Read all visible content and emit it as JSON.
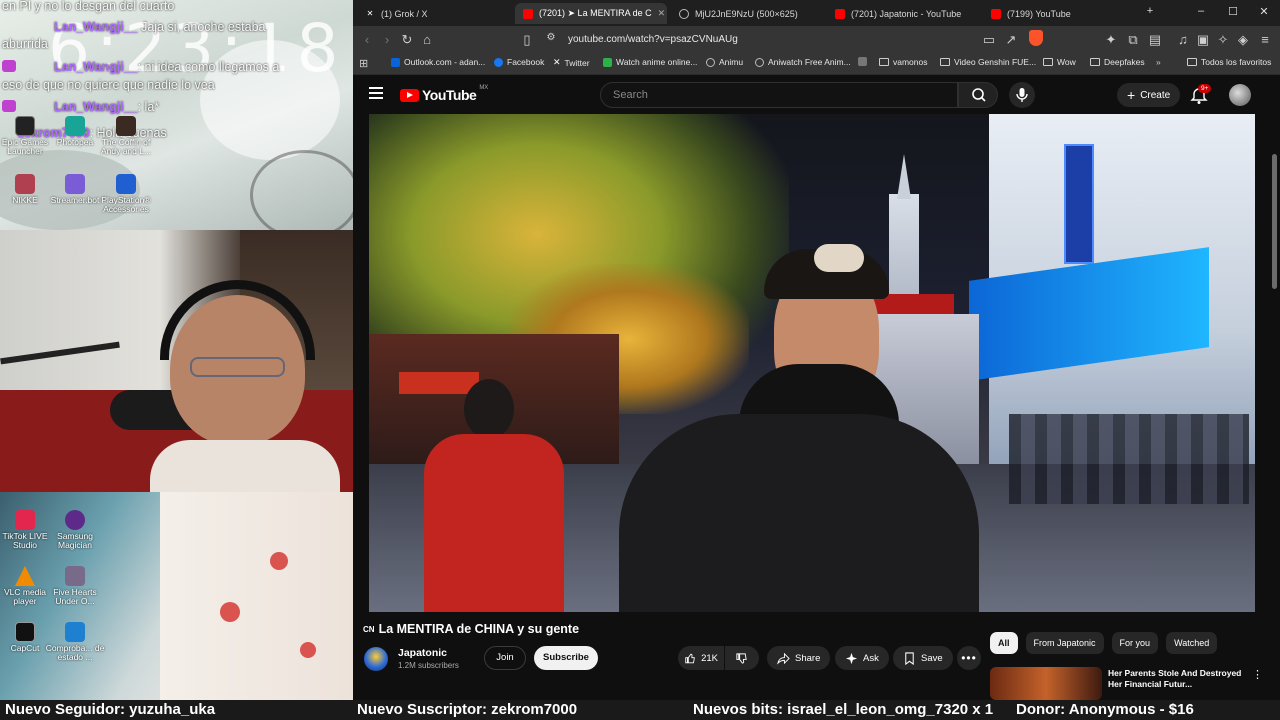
{
  "overlay": {
    "clock": "6:23:18",
    "chat": [
      {
        "user": "",
        "text": "en PI y no lo desgan del cuarto"
      },
      {
        "user": "Lan_Wangji__",
        "text": "Jaja si, anoche estaba"
      },
      {
        "user": "",
        "text": "aburrida"
      },
      {
        "user": "Lan_Wangji__",
        "text": ": ni idea como llegamos a"
      },
      {
        "user": "",
        "text": "eso de que no quiere que nadie lo vea"
      },
      {
        "user": "Lan_Wangji__",
        "text": ": la*"
      },
      {
        "user": "zekrom7000",
        "text": ": Hola buenas"
      }
    ],
    "desktop_icons": [
      {
        "label": "Epic Games Launcher",
        "icon": "epic-games-icon",
        "color": "#222222"
      },
      {
        "label": "Photopea",
        "icon": "photopea-icon",
        "color": "#18a497"
      },
      {
        "label": "The Coffin of Andy and L...",
        "icon": "coffin-game-icon",
        "color": "#3a2a22"
      },
      {
        "label": "NIKKE",
        "icon": "nikke-icon",
        "color": "#b04050"
      },
      {
        "label": "Streamer.bot",
        "icon": "streamerbot-icon",
        "color": "#7a5cd6"
      },
      {
        "label": "PlayStation® Accessories",
        "icon": "playstation-icon",
        "color": "#1f5fd0"
      },
      {
        "label": "TikTok LIVE Studio",
        "icon": "tiktok-icon",
        "color": "#e3264d"
      },
      {
        "label": "Samsung Magician",
        "icon": "samsung-magician-icon",
        "color": "#5d2a8a"
      },
      {
        "label": "VLC media player",
        "icon": "vlc-icon",
        "color": "#f08a00"
      },
      {
        "label": "Five Hearts Under O...",
        "icon": "five-hearts-icon",
        "color": "#7a6a8a"
      },
      {
        "label": "CapCut",
        "icon": "capcut-icon",
        "color": "#111111"
      },
      {
        "label": "Comproba... de estado ...",
        "icon": "status-check-icon",
        "color": "#1f7fd0"
      }
    ]
  },
  "browser": {
    "tabs": [
      {
        "title": "(1) Grok / X",
        "icon": "x-icon",
        "active": false
      },
      {
        "title": "(7201) ➤ La MENTIRA de C",
        "icon": "youtube-icon",
        "active": true
      },
      {
        "title": "MjU2JnE9NzU (500×625)",
        "icon": "globe-icon",
        "active": false
      },
      {
        "title": "(7201) Japatonic - YouTube",
        "icon": "youtube-icon",
        "active": false
      },
      {
        "title": "(7199) YouTube",
        "icon": "youtube-icon",
        "active": false
      }
    ],
    "url": "youtube.com/watch?v=psazCVNuAUg",
    "bookmarks": [
      {
        "label": "Outlook.com - adan...",
        "color": "#0a64d8"
      },
      {
        "label": "Facebook",
        "color": "#1877f2"
      },
      {
        "label": "Twitter",
        "color": "#000000"
      },
      {
        "label": "Watch anime online...",
        "color": "#2bb34a"
      },
      {
        "label": "Animu",
        "color": "#777777"
      },
      {
        "label": "Aniwatch Free Anim...",
        "color": "#777777"
      },
      {
        "label": "",
        "color": "#777777"
      },
      {
        "label": "vamonos",
        "color": "folder"
      },
      {
        "label": "Video Genshin FUE...",
        "color": "folder"
      },
      {
        "label": "Wow",
        "color": "folder"
      },
      {
        "label": "Deepfakes",
        "color": "folder"
      }
    ],
    "bookmarks_all": "Todos los favoritos"
  },
  "youtube": {
    "logo_text": "YouTube",
    "logo_country": "MX",
    "search_placeholder": "Search",
    "create_label": "Create",
    "notif_count": "9+",
    "video_title": "La MENTIRA de CHINA y su gente",
    "title_flag": "CN",
    "channel": {
      "name": "Japatonic",
      "subs": "1.2M subscribers",
      "join": "Join",
      "subscribe": "Subscribe"
    },
    "actions": {
      "likes": "21K",
      "share": "Share",
      "ask": "Ask",
      "save": "Save"
    },
    "chips": [
      "All",
      "From Japatonic",
      "For you",
      "Watched"
    ],
    "rec_title": "Her Parents Stole And Destroyed Her Financial Futur..."
  },
  "ticker": {
    "follower": "Nuevo Seguidor: yuzuha_uka",
    "subscriber": "Nuevo Suscriptor: zekrom7000",
    "bits": "Nuevos bits: israel_el_leon_omg_7320 x 1",
    "donor": "Donor: Anonymous - $16"
  }
}
